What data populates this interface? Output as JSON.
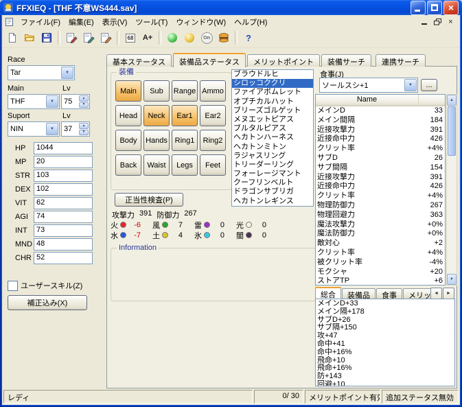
{
  "titlebar": {
    "title": "FFXIEQ - [THF 不意WS444.sav]"
  },
  "menubar": {
    "items": [
      "ファイル(F)",
      "編集(E)",
      "表示(V)",
      "ツール(T)",
      "ウィンドウ(W)",
      "ヘルプ(H)"
    ]
  },
  "icons": {
    "dropdown": "▼",
    "spin_up": "▲",
    "spin_down": "▼",
    "scroll_up": "▲",
    "scroll_down": "▼",
    "scroll_left": "◄",
    "scroll_right": "►",
    "close": "×",
    "badge_68": "68",
    "badge_a_plus": "A+",
    "on_badge": "On",
    "help": "?"
  },
  "colors": {
    "titlebar_blue": "#0653e4",
    "selection_blue": "#316ac5",
    "slot_highlight": "#f6c068",
    "negative_red": "#cc0000",
    "tab_accent_orange": "#f0a030"
  },
  "character": {
    "race_label": "Race",
    "race": "Tar",
    "main_label": "Main",
    "main_job": "THF",
    "main_lv_label": "Lv",
    "main_lv": "75",
    "support_label": "Suport",
    "support_job": "NIN",
    "support_lv_label": "Lv",
    "support_lv": "37",
    "stats": [
      {
        "label": "HP",
        "value": "1044"
      },
      {
        "label": "MP",
        "value": "20"
      },
      {
        "label": "STR",
        "value": "103"
      },
      {
        "label": "DEX",
        "value": "102"
      },
      {
        "label": "VIT",
        "value": "62"
      },
      {
        "label": "AGI",
        "value": "74"
      },
      {
        "label": "INT",
        "value": "73"
      },
      {
        "label": "MND",
        "value": "48"
      },
      {
        "label": "CHR",
        "value": "52"
      }
    ],
    "user_skill": "ユーザースキル(Z)",
    "correction_button": "補正込み(X)"
  },
  "main_tabs": [
    {
      "label": "基本ステータス",
      "active": false
    },
    {
      "label": "装備品ステータス",
      "active": true
    },
    {
      "label": "メリットポイント",
      "active": false
    },
    {
      "label": "装備サーチ",
      "active": false
    },
    {
      "label": "連携サーチ",
      "active": false
    }
  ],
  "equipment": {
    "group_label": "装備",
    "slots": [
      {
        "label": "Main",
        "active": true
      },
      {
        "label": "Sub",
        "active": false
      },
      {
        "label": "Range",
        "active": false
      },
      {
        "label": "Ammo",
        "active": false
      },
      {
        "label": "Head",
        "active": false
      },
      {
        "label": "Neck",
        "active": true
      },
      {
        "label": "Ear1",
        "active": true
      },
      {
        "label": "Ear2",
        "active": false
      },
      {
        "label": "Body",
        "active": false
      },
      {
        "label": "Hands",
        "active": false
      },
      {
        "label": "Ring1",
        "active": false
      },
      {
        "label": "Ring2",
        "active": false
      },
      {
        "label": "Back",
        "active": false
      },
      {
        "label": "Waist",
        "active": false
      },
      {
        "label": "Legs",
        "active": false
      },
      {
        "label": "Feet",
        "active": false
      }
    ],
    "validate_button": "正当性検査(P)",
    "attack_label": "攻撃力",
    "attack_value": "391",
    "defense_label": "防御力",
    "defense_value": "267",
    "elements": [
      {
        "kanji": "火",
        "color": "#e8262b",
        "value": "-6",
        "negative": true
      },
      {
        "kanji": "風",
        "color": "#27a52c",
        "value": "7",
        "negative": false
      },
      {
        "kanji": "雷",
        "color": "#9b30c8",
        "value": "0",
        "negative": false
      },
      {
        "kanji": "光",
        "color": "#f4f2dc",
        "value": "0",
        "negative": false
      },
      {
        "kanji": "水",
        "color": "#2656e0",
        "value": "-7",
        "negative": true
      },
      {
        "kanji": "土",
        "color": "#d8c62a",
        "value": "4",
        "negative": false
      },
      {
        "kanji": "氷",
        "color": "#35c8e8",
        "value": "0",
        "negative": false
      },
      {
        "kanji": "闇",
        "color": "#4a3350",
        "value": "0",
        "negative": false
      }
    ],
    "info_label": "Information"
  },
  "equipment_list": {
    "items": [
      {
        "name": "ブラウドルヒ",
        "selected": false
      },
      {
        "name": "シロッコククリ",
        "selected": true
      },
      {
        "name": "ファイアボムレット",
        "selected": false
      },
      {
        "name": "オプチカルハット",
        "selected": false
      },
      {
        "name": "ブリーズゴルゲット",
        "selected": false
      },
      {
        "name": "メヌエットピアス",
        "selected": false
      },
      {
        "name": "ブルタルピアス",
        "selected": false
      },
      {
        "name": "ヘカトンハーネス",
        "selected": false
      },
      {
        "name": "ヘカトンミトン",
        "selected": false
      },
      {
        "name": "ラジャスリング",
        "selected": false
      },
      {
        "name": "トリーダーリング",
        "selected": false
      },
      {
        "name": "フォーレージマント",
        "selected": false
      },
      {
        "name": "クーフリンベルト",
        "selected": false
      },
      {
        "name": "ドラゴンサブリガ",
        "selected": false
      },
      {
        "name": "ヘカトンレギンス",
        "selected": false
      }
    ]
  },
  "food": {
    "label": "食事(J)",
    "value": "ソールスシ+1",
    "browse": "..."
  },
  "stats_table": {
    "header": "Name",
    "rows": [
      {
        "name": "メインD",
        "value": "33"
      },
      {
        "name": "メイン間隔",
        "value": "184"
      },
      {
        "name": "近接攻撃力",
        "value": "391"
      },
      {
        "name": "近接命中力",
        "value": "426"
      },
      {
        "name": "クリット率",
        "value": "+4%"
      },
      {
        "name": "サブD",
        "value": "26"
      },
      {
        "name": "サブ間隔",
        "value": "154"
      },
      {
        "name": "近接攻撃力",
        "value": "391"
      },
      {
        "name": "近接命中力",
        "value": "426"
      },
      {
        "name": "クリット率",
        "value": "+4%"
      },
      {
        "name": "物理防御力",
        "value": "267"
      },
      {
        "name": "物理回避力",
        "value": "363"
      },
      {
        "name": "魔法攻撃力",
        "value": "+0%"
      },
      {
        "name": "魔法防御力",
        "value": "+0%"
      },
      {
        "name": "敵対心",
        "value": "+2"
      },
      {
        "name": "クリット率",
        "value": "+4%"
      },
      {
        "name": "被クリット率",
        "value": "-4%"
      },
      {
        "name": "モクシャ",
        "value": "+20"
      },
      {
        "name": "ストアTP",
        "value": "+6"
      }
    ]
  },
  "result_tabs": [
    {
      "label": "総合",
      "active": true
    },
    {
      "label": "装備品",
      "active": false
    },
    {
      "label": "食事",
      "active": false
    },
    {
      "label": "メリッ",
      "active": false
    }
  ],
  "summary_lines": [
    "メインD+33",
    "メイン隔+178",
    "サブD+26",
    "サブ隔+150",
    "攻+47",
    "命中+41",
    "命中+16%",
    "飛命+10",
    "飛命+16%",
    "防+143",
    "回避+10"
  ],
  "statusbar": {
    "ready": "レディ",
    "count": "0/ 30",
    "merit": "メリットポイント有効",
    "extra": "追加ステータス無効"
  }
}
